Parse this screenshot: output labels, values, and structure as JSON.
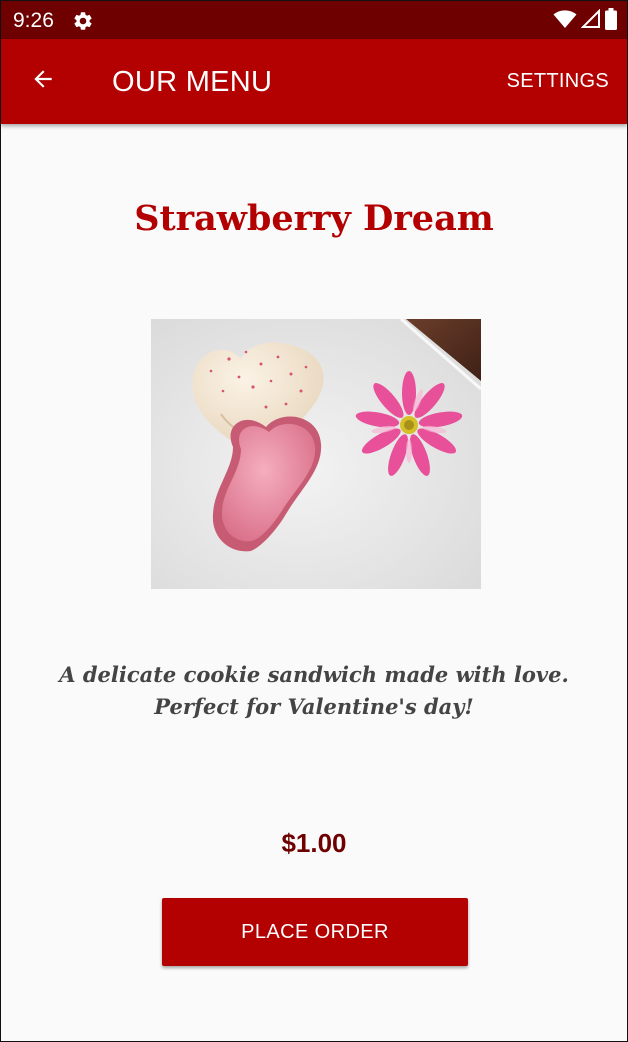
{
  "status_bar": {
    "time": "9:26",
    "icons": [
      "gear-icon",
      "wifi-icon",
      "signal-icon",
      "battery-icon"
    ]
  },
  "app_bar": {
    "title": "OUR MENU",
    "settings_label": "SETTINGS",
    "back_icon": "arrow-back-icon"
  },
  "product": {
    "name": "Strawberry Dream",
    "image_icon": "heart-macarons-with-pink-flower",
    "description_line1": "A delicate cookie sandwich made with love.",
    "description_line2": "Perfect for Valentine's day!",
    "price": "$1.00",
    "order_label": "PLACE ORDER"
  },
  "colors": {
    "status_bar": "#6e0000",
    "app_bar": "#b30000",
    "accent": "#b30000",
    "price": "#6e0000",
    "description": "#444444",
    "background": "#fafafa"
  }
}
